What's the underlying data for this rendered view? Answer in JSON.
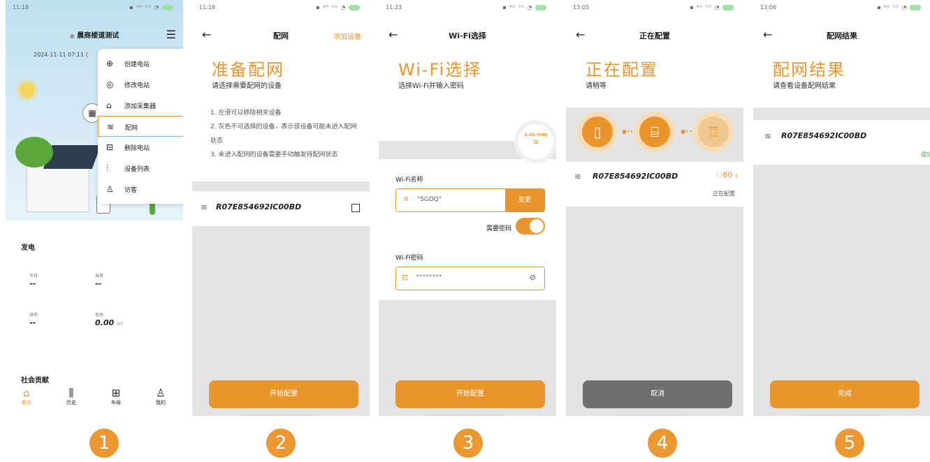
{
  "p1": {
    "time": "11:18",
    "title": "晨商楼道测试",
    "date": "2024-11-11 07:11 (",
    "menu": [
      "创建电站",
      "修改电站",
      "添加采集器",
      "配网",
      "删除电站",
      "设备列表",
      "访客"
    ],
    "gen_title": "发电",
    "stats": [
      {
        "label": "今日",
        "value": "--"
      },
      {
        "label": "当月",
        "value": "--"
      },
      {
        "label": "当年",
        "value": "--"
      },
      {
        "label": "总共",
        "value": "0.00",
        "unit": "Wh"
      }
    ],
    "social_title": "社会贡献",
    "tabs": [
      "概览",
      "历史",
      "布局",
      "我的"
    ]
  },
  "p2": {
    "time": "11:18",
    "nav_title": "配网",
    "nav_right": "添加设备",
    "title": "准备配网",
    "subtitle": "请选择需要配网的设备",
    "notes": [
      "1. 左滑可以移除相关设备",
      "2. 灰色不可选择的设备，表示该设备可能未进入配网状态",
      "3. 未进入配网的设备需要手动触发待配网状态"
    ],
    "device": "R07E854692IC00BD",
    "button": "开始配置"
  },
  "p3": {
    "time": "11:23",
    "nav_title": "Wi-Fi选择",
    "title": "Wi-Fi选择",
    "subtitle": "选择Wi-Fi并输入密码",
    "badge": "2.4G Only",
    "ssid_label": "Wi-Fi名称",
    "ssid": "\"SGDQ\"",
    "change": "变更",
    "need_pwd": "需要密码",
    "pwd_label": "Wi-Fi密码",
    "pwd_placeholder": "••••••••",
    "button": "开始配置"
  },
  "p4": {
    "time": "13:05",
    "nav_title": "正在配置",
    "title": "正在配置",
    "subtitle": "请稍等",
    "device": "R07E854692IC00BD",
    "countdown": "60",
    "countdown_unit": "s",
    "status": "正在配置",
    "button": "取消"
  },
  "p5": {
    "time": "13:06",
    "nav_title": "配网结果",
    "title": "配网结果",
    "subtitle": "请查看设备配网结果",
    "device": "R07E854692IC00BD",
    "status": "成功",
    "button": "完成"
  },
  "steps": [
    "1",
    "2",
    "3",
    "4",
    "5"
  ],
  "colors": {
    "accent": "#E9952C",
    "grey_bg": "#e4e4e4",
    "cancel": "#6f6f6f"
  }
}
